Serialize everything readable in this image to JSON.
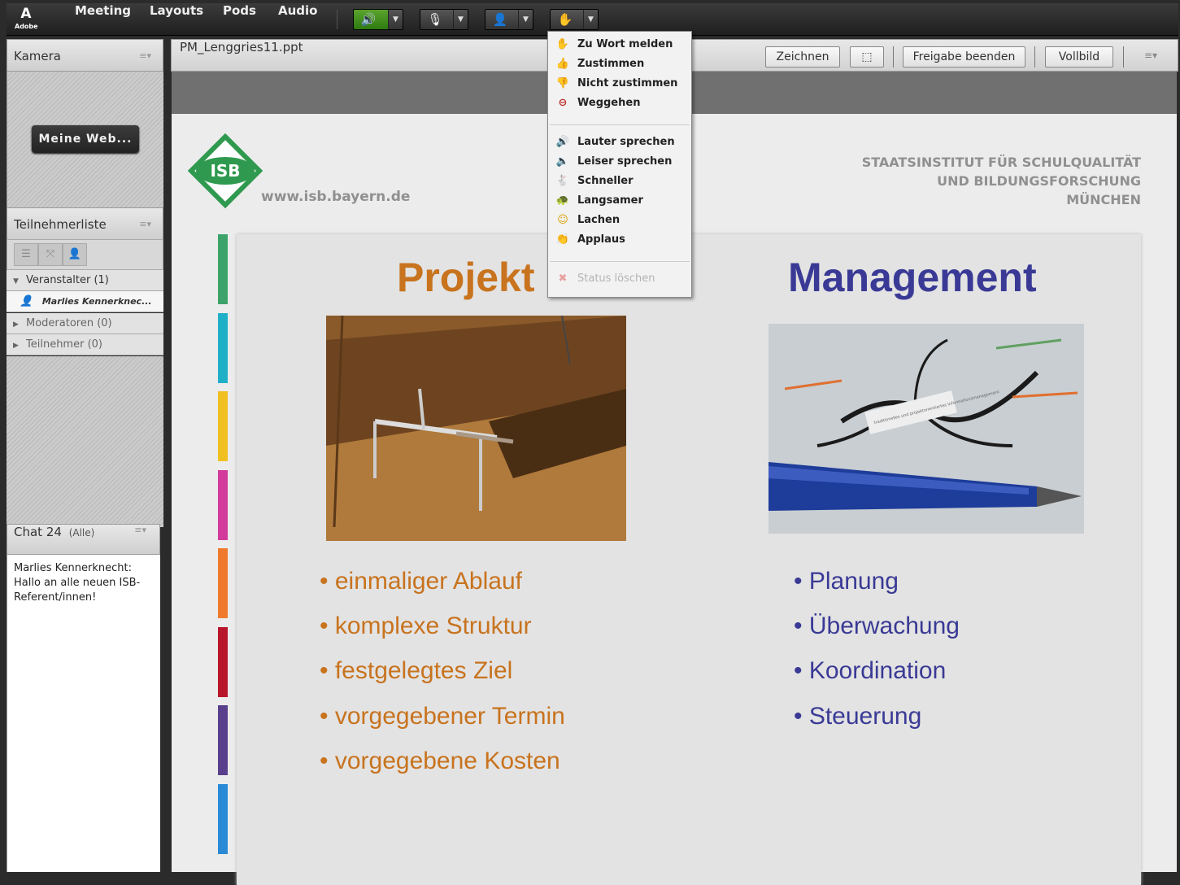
{
  "app": {
    "logo_text": "Adobe",
    "logo_mark": "A"
  },
  "menu": [
    "Meeting",
    "Layouts",
    "Pods",
    "Audio"
  ],
  "toolbar_icons": [
    "speaker-icon",
    "microphone-icon",
    "webcam-icon",
    "status-icon"
  ],
  "camera_pod": {
    "title": "Kamera",
    "button_label": "Meine Web..."
  },
  "attendee_pod": {
    "title": "Teilnehmerliste",
    "groups": [
      {
        "label": "Veranstalter (1)",
        "expanded": true
      },
      {
        "label": "Marlies Kennerknec...",
        "is_user": true
      },
      {
        "label": "Moderatoren (0)",
        "expanded": false
      },
      {
        "label": "Teilnehmer (0)",
        "expanded": false
      }
    ]
  },
  "chat_pod": {
    "title": "Chat 24",
    "scope": "(Alle)",
    "messages": [
      {
        "author": "Marlies Kennerknecht:",
        "text": "Hallo an alle neuen ISB-Referent/innen!"
      }
    ]
  },
  "share_pod": {
    "filename": "PM_Lenggries11.ppt",
    "draw_label": "Zeichnen",
    "stop_label": "Freigabe beenden",
    "fullscreen_label": "Vollbild"
  },
  "slide": {
    "logo_text": "ISB",
    "url": "www.isb.bayern.de",
    "institute_lines": [
      "STAATSINSTITUT FÜR SCHULQUALITÄT",
      "UND BILDUNGSFORSCHUNG",
      "MÜNCHEN"
    ],
    "left_title": "Projekt",
    "right_title": "Management",
    "left_bullets": [
      "• einmaliger Ablauf",
      "• komplexe Struktur",
      "• festgelegtes Ziel",
      "• vorgegebener Termin",
      "• vorgegebene Kosten"
    ],
    "right_bullets": [
      "• Planung",
      "• Überwachung",
      "• Koordination",
      "• Steuerung"
    ],
    "photo2_note_text": "traditionelles und projektorientiertes Informationsmanagement",
    "stripe_colors": [
      "#3da36a",
      "#1fb0c8",
      "#f0c020",
      "#d23a9c",
      "#ef7a2e",
      "#b8162b",
      "#5a3f8c",
      "#2a8ad6"
    ],
    "left_color": "#c8731e",
    "right_color": "#3a3a96"
  },
  "status_menu": {
    "items": [
      {
        "label": "Zu Wort melden",
        "icon": "raise-hand-icon"
      },
      {
        "label": "Zustimmen",
        "icon": "thumbs-up-icon"
      },
      {
        "label": "Nicht zustimmen",
        "icon": "thumbs-down-icon"
      },
      {
        "label": "Weggehen",
        "icon": "away-icon"
      },
      {
        "label": "Lauter sprechen",
        "icon": "louder-icon"
      },
      {
        "label": "Leiser sprechen",
        "icon": "quieter-icon"
      },
      {
        "label": "Schneller",
        "icon": "faster-icon"
      },
      {
        "label": "Langsamer",
        "icon": "slower-icon"
      },
      {
        "label": "Lachen",
        "icon": "laugh-icon"
      },
      {
        "label": "Applaus",
        "icon": "applause-icon"
      },
      {
        "label": "Status löschen",
        "icon": "clear-status-icon",
        "disabled": true
      }
    ]
  }
}
